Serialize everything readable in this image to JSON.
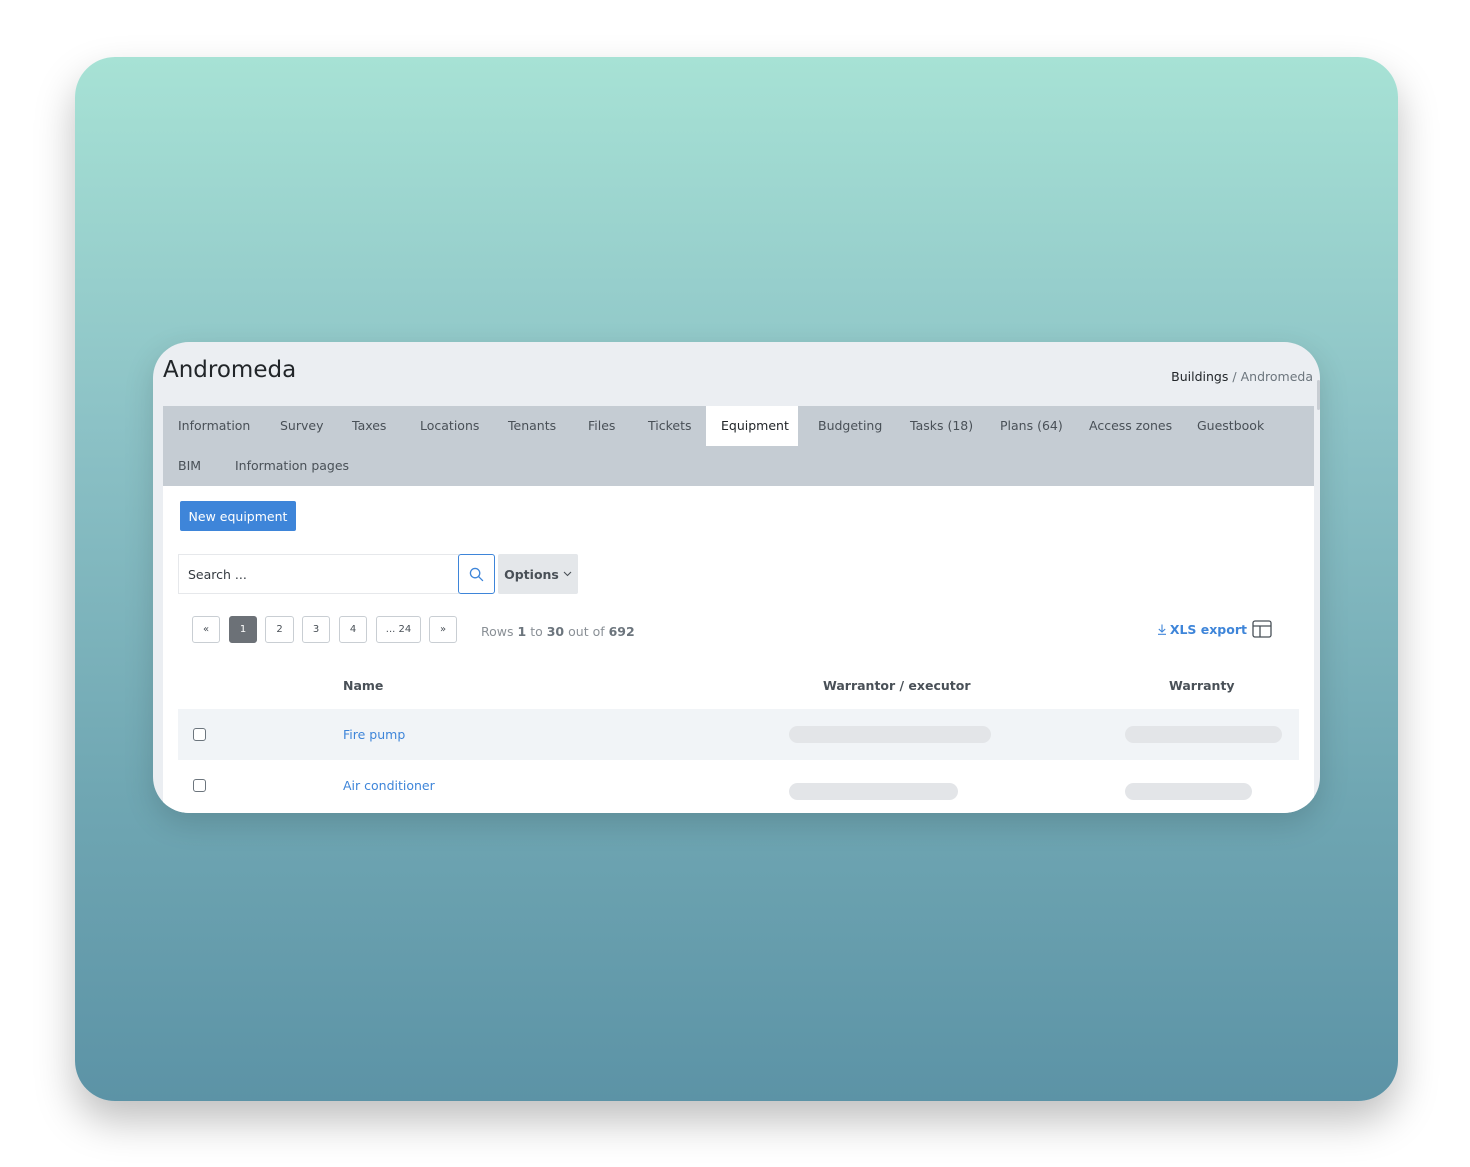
{
  "page": {
    "title": "Andromeda",
    "breadcrumb": {
      "parent": "Buildings",
      "separator": "/",
      "current": "Andromeda"
    }
  },
  "tabs": [
    {
      "label": "Information"
    },
    {
      "label": "Survey"
    },
    {
      "label": "Taxes"
    },
    {
      "label": "Locations"
    },
    {
      "label": "Tenants"
    },
    {
      "label": "Files"
    },
    {
      "label": "Tickets"
    },
    {
      "label": "Equipment",
      "active": true
    },
    {
      "label": "Budgeting"
    },
    {
      "label": "Tasks (18)"
    },
    {
      "label": "Plans (64)"
    },
    {
      "label": "Access zones"
    },
    {
      "label": "Guestbook"
    },
    {
      "label": "BIM"
    },
    {
      "label": "Information pages"
    }
  ],
  "toolbar": {
    "new_button": "New equipment",
    "search_placeholder": "Search ...",
    "options_label": "Options",
    "xls_export": "XLS export"
  },
  "pagination": {
    "prev": "«",
    "pages": [
      "1",
      "2",
      "3",
      "4",
      "... 24"
    ],
    "next": "»",
    "active_page": "1",
    "rows_prefix": "Rows",
    "rows_from": "1",
    "rows_to_word": "to",
    "rows_to": "30",
    "rows_out_of": "out of",
    "rows_total": "692"
  },
  "table": {
    "columns": [
      "Name",
      "Warrantor / executor",
      "Warranty"
    ],
    "rows": [
      {
        "name": "Fire pump"
      },
      {
        "name": "Air conditioner"
      }
    ]
  },
  "colors": {
    "accent": "#3e85d9",
    "tab_bar": "#c5ccd3",
    "header_bg": "#ebeef2"
  }
}
